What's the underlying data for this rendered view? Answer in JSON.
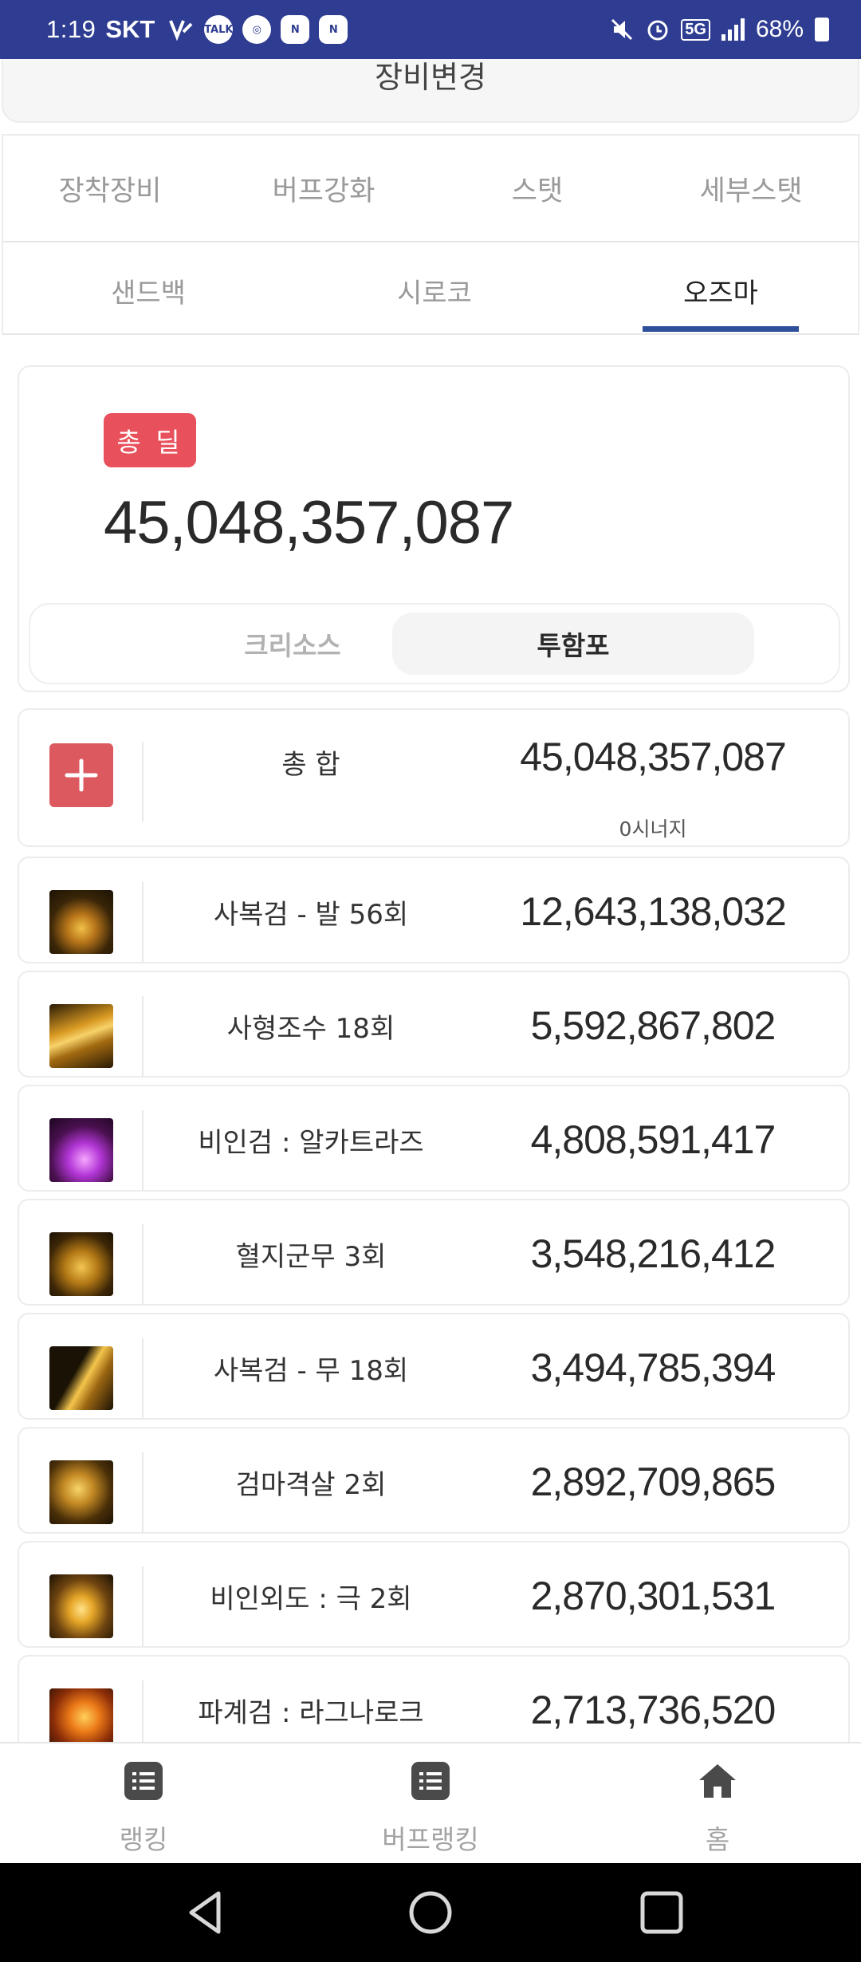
{
  "status_bar": {
    "time": "1:19",
    "carrier": "SKT",
    "left_icons": [
      "vpn-icon",
      "talk-icon",
      "app-icon",
      "naver-icon",
      "naver-icon"
    ],
    "battery": "68%",
    "network": "5G"
  },
  "header": {
    "title": "장비변경"
  },
  "primary_tabs": [
    "장착장비",
    "버프강화",
    "스탯",
    "세부스탯"
  ],
  "secondary_tabs": {
    "items": [
      "샌드백",
      "시로코",
      "오즈마"
    ],
    "active": "오즈마"
  },
  "total": {
    "badge": "총 딜",
    "value": "45,048,357,087",
    "toggle": {
      "options": [
        "크리소스",
        "투함포"
      ],
      "active": "투함포"
    }
  },
  "summary_row": {
    "name": "총 합",
    "value": "45,048,357,087",
    "synergy": "0시너지"
  },
  "skills": [
    {
      "name": "사복검 - 발 56회",
      "value": "12,643,138,032",
      "icon": "skill-icon"
    },
    {
      "name": "사형조수 18회",
      "value": "5,592,867,802",
      "icon": "skill-icon"
    },
    {
      "name": "비인검 : 알카트라즈",
      "value": "4,808,591,417",
      "icon": "skill-icon"
    },
    {
      "name": "혈지군무 3회",
      "value": "3,548,216,412",
      "icon": "skill-icon"
    },
    {
      "name": "사복검 - 무 18회",
      "value": "3,494,785,394",
      "icon": "skill-icon"
    },
    {
      "name": "검마격살 2회",
      "value": "2,892,709,865",
      "icon": "skill-icon"
    },
    {
      "name": "비인외도 : 극 2회",
      "value": "2,870,301,531",
      "icon": "skill-icon"
    },
    {
      "name": "파계검 : 라그나로크",
      "value": "2,713,736,520",
      "icon": "skill-icon"
    }
  ],
  "bottom_nav": [
    {
      "label": "랭킹",
      "icon": "list-icon"
    },
    {
      "label": "버프랭킹",
      "icon": "list-icon"
    },
    {
      "label": "홈",
      "icon": "home-icon"
    }
  ],
  "colors": {
    "status_bar": "#2e3c91",
    "badge": "#e8505b",
    "tab_underline": "#2e4f9a",
    "sum_icon": "#dc5a5f"
  }
}
